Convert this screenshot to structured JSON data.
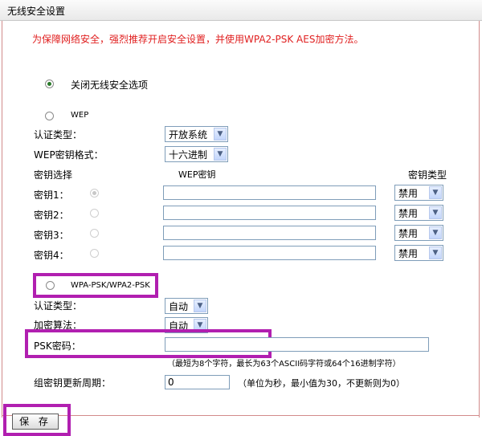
{
  "window": {
    "title": "无线安全设置"
  },
  "notice": "为保障网络安全，强烈推荐开启安全设置，并使用WPA2-PSK AES加密方法。",
  "disable_security": {
    "label": "关闭无线安全选项",
    "checked": true
  },
  "wep": {
    "label": "WEP",
    "checked": false,
    "auth_type_label": "认证类型：",
    "auth_type_value": "开放系统",
    "key_format_label": "WEP密钥格式：",
    "key_format_value": "十六进制",
    "col_key_select": "密钥选择",
    "col_wep_key": "WEP密钥",
    "col_key_type": "密钥类型",
    "keys": [
      {
        "label": "密钥1：",
        "value": "",
        "type": "禁用",
        "selected": true
      },
      {
        "label": "密钥2：",
        "value": "",
        "type": "禁用",
        "selected": false
      },
      {
        "label": "密钥3：",
        "value": "",
        "type": "禁用",
        "selected": false
      },
      {
        "label": "密钥4：",
        "value": "",
        "type": "禁用",
        "selected": false
      }
    ]
  },
  "wpa_psk": {
    "label": "WPA-PSK/WPA2-PSK",
    "checked": false,
    "auth_type_label": "认证类型：",
    "auth_type_value": "自动",
    "encryption_label": "加密算法：",
    "encryption_value": "自动",
    "psk_label": "PSK密码：",
    "psk_value": "",
    "psk_hint": "（最短为8个字符，最长为63个ASCII码字符或64个16进制字符）",
    "group_key_label": "组密钥更新周期：",
    "group_key_value": "0",
    "group_key_hint": "（单位为秒，最小值为30，不更新则为0）"
  },
  "save_button": "保 存",
  "colors": {
    "notice": "#e02020",
    "highlight": "#b11fb0",
    "border": "#d28b8b"
  }
}
